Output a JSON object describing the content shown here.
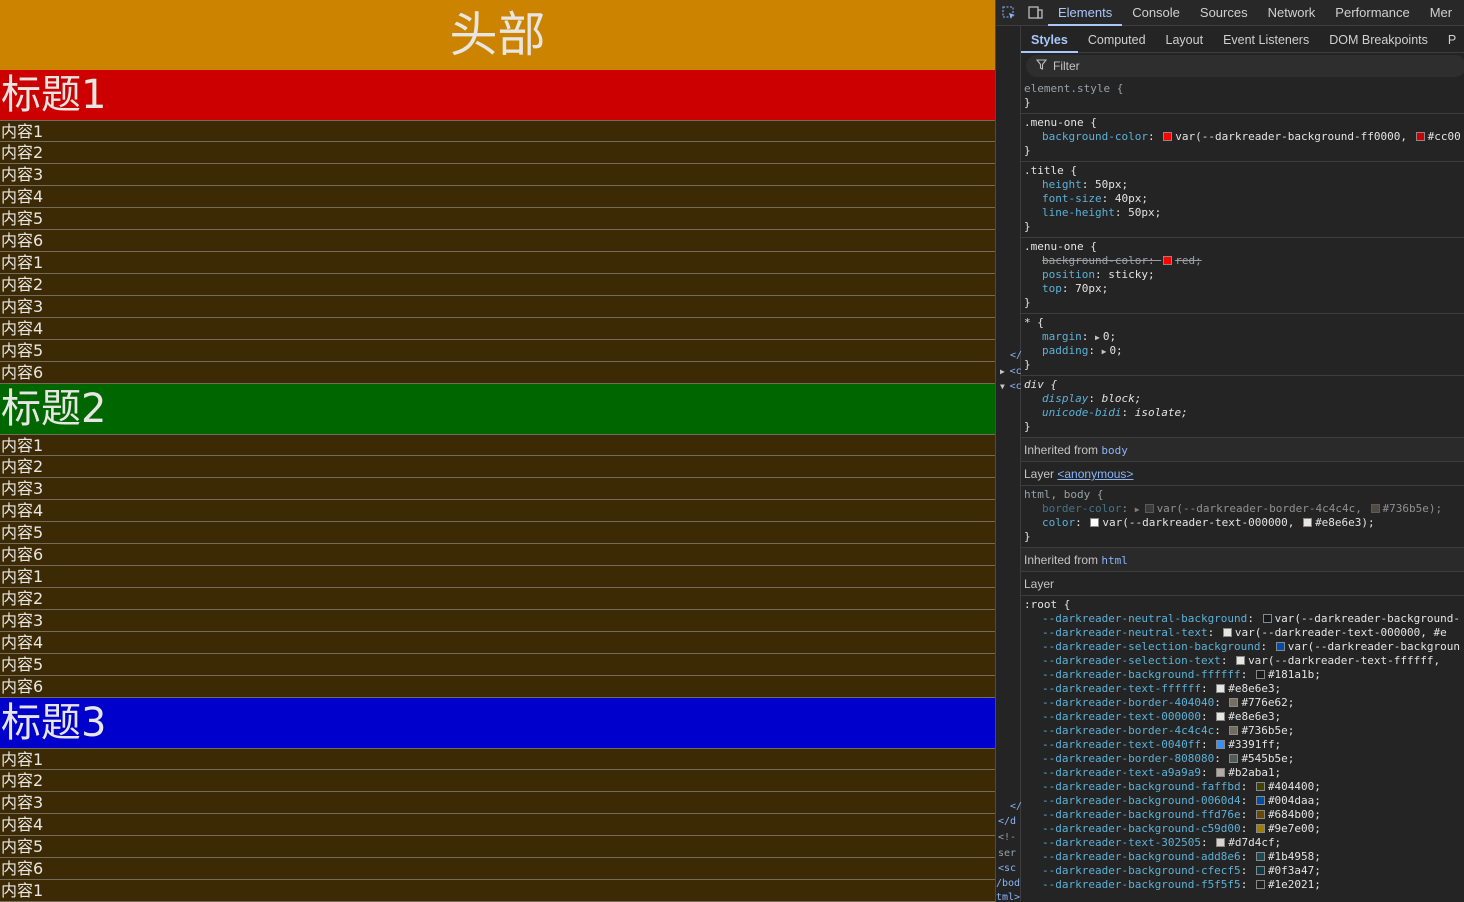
{
  "page": {
    "header": "头部",
    "sections": [
      {
        "title": "标题1",
        "color": "#cc0000",
        "items": [
          "内容1",
          "内容2",
          "内容3",
          "内容4",
          "内容5",
          "内容6",
          "内容1",
          "内容2",
          "内容3",
          "内容4",
          "内容5",
          "内容6"
        ]
      },
      {
        "title": "标题2",
        "color": "#006600",
        "items": [
          "内容1",
          "内容2",
          "内容3",
          "内容4",
          "内容5",
          "内容6",
          "内容1",
          "内容2",
          "内容3",
          "内容4",
          "内容5",
          "内容6"
        ]
      },
      {
        "title": "标题3",
        "color": "#0000cc",
        "items": [
          "内容1",
          "内容2",
          "内容3",
          "内容4",
          "内容5",
          "内容6",
          "内容1"
        ]
      }
    ]
  },
  "devtools": {
    "tabs": [
      "Elements",
      "Console",
      "Sources",
      "Network",
      "Performance",
      "Mer"
    ],
    "subtabs": [
      "Styles",
      "Computed",
      "Layout",
      "Event Listeners",
      "DOM Breakpoints",
      "P"
    ],
    "filter_placeholder": "Filter",
    "gutter": [
      "</",
      "<c",
      "<c",
      "</",
      "</d",
      "<!-",
      "ser",
      "<sc",
      "/bod",
      "tml>"
    ],
    "rules": {
      "element_style": "element.style {",
      "close": "}",
      "menu_one_sel": ".menu-one {",
      "bg_prop": "background-color",
      "bg_val_1": "var(--darkreader-background-ff0000,",
      "bg_val_2": "#cc00",
      "title_sel": ".title {",
      "height_prop": "height",
      "height_val": "50px;",
      "fs_prop": "font-size",
      "fs_val": "40px;",
      "lh_prop": "line-height",
      "lh_val": "50px;",
      "bg_red_val": "red;",
      "pos_prop": "position",
      "pos_val": "sticky;",
      "top_prop": "top",
      "top_val": "70px;",
      "star_sel": "* {",
      "margin_prop": "margin",
      "margin_val": "0;",
      "padding_prop": "padding",
      "padding_val": "0;",
      "div_sel": "div {",
      "display_prop": "display",
      "display_val": "block;",
      "ub_prop": "unicode-bidi",
      "ub_val": "isolate;",
      "inherited_body": "Inherited from",
      "body_link": "body",
      "layer_label": "Layer",
      "layer_anon": "<anonymous>",
      "html_body_sel": "html, body {",
      "border_color_prop": "border-color",
      "border_color_val": "var(--darkreader-border-4c4c4c,",
      "border_color_val2": "#736b5e);",
      "color_prop": "color",
      "color_val": "var(--darkreader-text-000000,",
      "color_val2": "#e8e6e3);",
      "inherited_html": "Inherited from",
      "html_link": "html",
      "layer2": "Layer",
      "root_sel": ":root {"
    },
    "root_vars": [
      {
        "name": "--darkreader-neutral-background",
        "value": "var(--darkreader-background-",
        "swatch": "#181a1b"
      },
      {
        "name": "--darkreader-neutral-text",
        "value": "var(--darkreader-text-000000, #e",
        "swatch": "#e8e6e3"
      },
      {
        "name": "--darkreader-selection-background",
        "value": "var(--darkreader-backgroun",
        "swatch": "#004daa"
      },
      {
        "name": "--darkreader-selection-text",
        "value": "var(--darkreader-text-ffffff,",
        "swatch": "#e8e6e3"
      },
      {
        "name": "--darkreader-background-ffffff",
        "value": "#181a1b;",
        "swatch": "#181a1b"
      },
      {
        "name": "--darkreader-text-ffffff",
        "value": "#e8e6e3;",
        "swatch": "#e8e6e3"
      },
      {
        "name": "--darkreader-border-404040",
        "value": "#776e62;",
        "swatch": "#776e62"
      },
      {
        "name": "--darkreader-text-000000",
        "value": "#e8e6e3;",
        "swatch": "#e8e6e3"
      },
      {
        "name": "--darkreader-border-4c4c4c",
        "value": "#736b5e;",
        "swatch": "#736b5e"
      },
      {
        "name": "--darkreader-text-0040ff",
        "value": "#3391ff;",
        "swatch": "#3391ff"
      },
      {
        "name": "--darkreader-border-808080",
        "value": "#545b5e;",
        "swatch": "#545b5e"
      },
      {
        "name": "--darkreader-text-a9a9a9",
        "value": "#b2aba1;",
        "swatch": "#b2aba1"
      },
      {
        "name": "--darkreader-background-faffbd",
        "value": "#404400;",
        "swatch": "#404400"
      },
      {
        "name": "--darkreader-background-0060d4",
        "value": "#004daa;",
        "swatch": "#004daa"
      },
      {
        "name": "--darkreader-background-ffd76e",
        "value": "#684b00;",
        "swatch": "#684b00"
      },
      {
        "name": "--darkreader-background-c59d00",
        "value": "#9e7e00;",
        "swatch": "#9e7e00"
      },
      {
        "name": "--darkreader-text-302505",
        "value": "#d7d4cf;",
        "swatch": "#d7d4cf"
      },
      {
        "name": "--darkreader-background-add8e6",
        "value": "#1b4958;",
        "swatch": "#1b4958"
      },
      {
        "name": "--darkreader-background-cfecf5",
        "value": "#0f3a47;",
        "swatch": "#0f3a47"
      },
      {
        "name": "--darkreader-background-f5f5f5",
        "value": "#1e2021;",
        "swatch": "#1e2021"
      }
    ]
  }
}
